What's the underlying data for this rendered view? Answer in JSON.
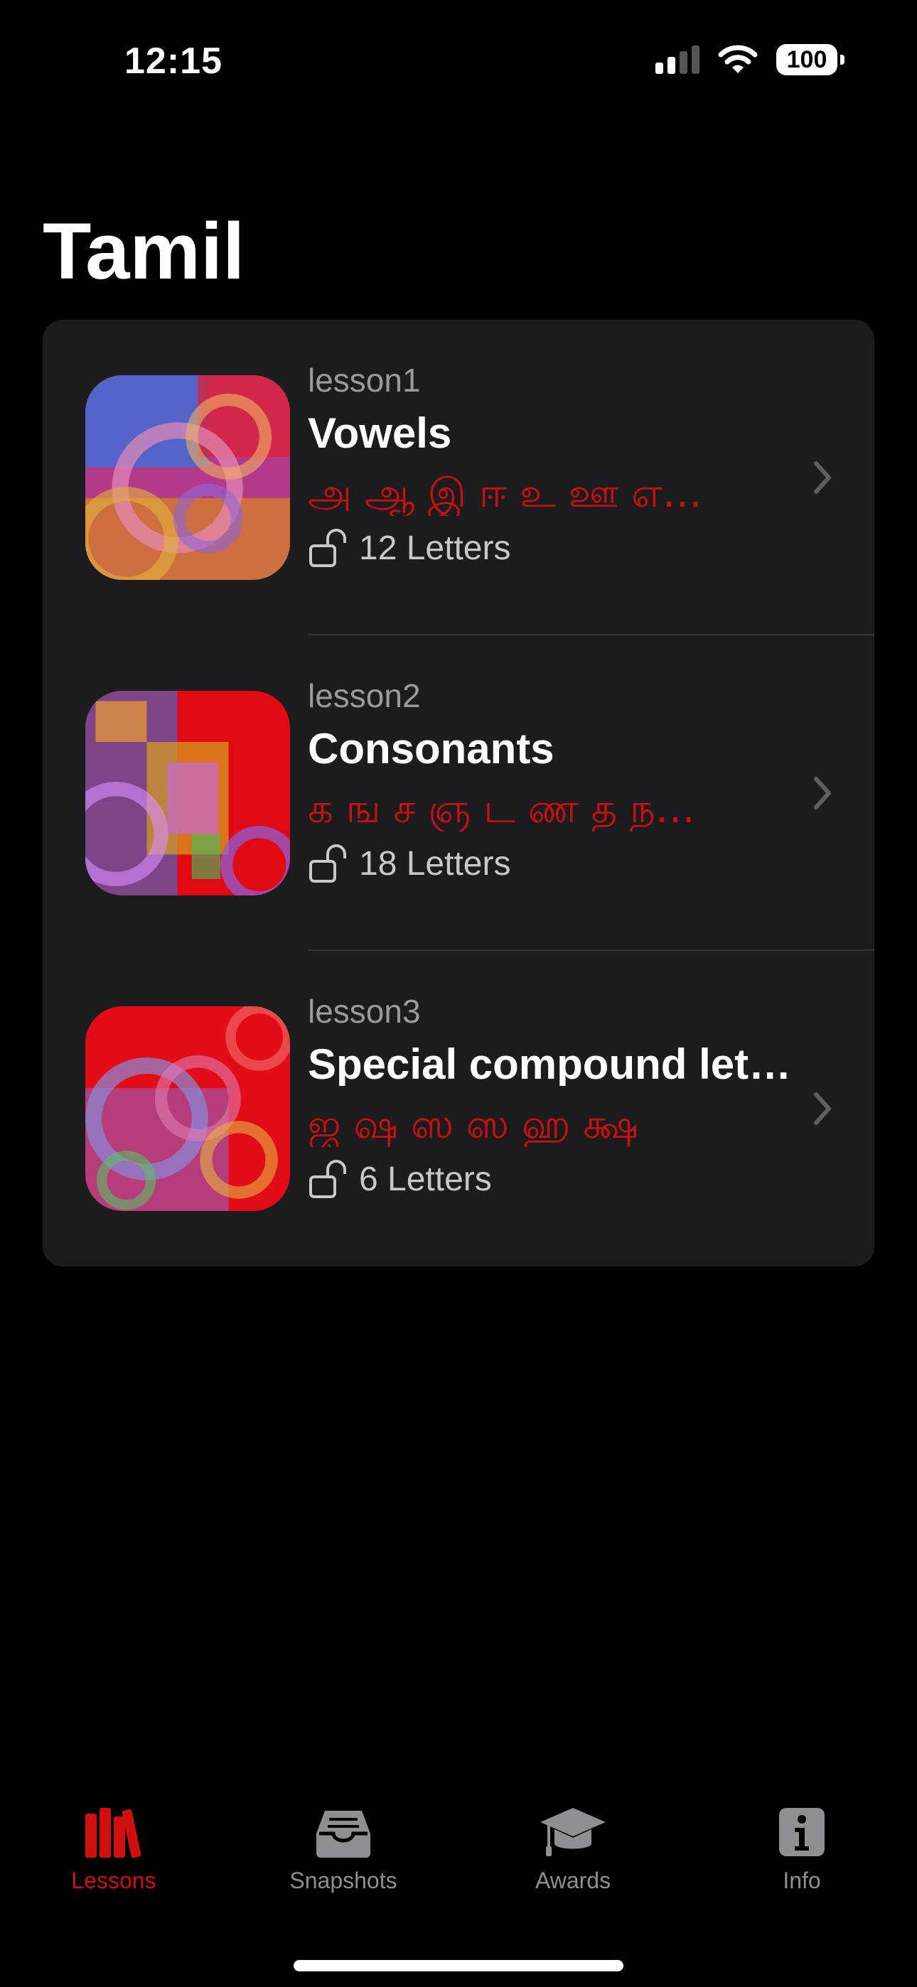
{
  "status": {
    "time": "12:15",
    "battery": "100"
  },
  "title": "Tamil",
  "lessons": [
    {
      "id": "lesson1",
      "title": "Vowels",
      "letters": "அ ஆ இ ஈ உ ஊ எ…",
      "count": "12 Letters"
    },
    {
      "id": "lesson2",
      "title": "Consonants",
      "letters": "க ங ச ஞ ட ண த ந…",
      "count": "18 Letters"
    },
    {
      "id": "lesson3",
      "title": "Special compound let…",
      "letters": "ஜ ஷ ஸ ஸ ஹ க்ஷ",
      "count": "6 Letters"
    }
  ],
  "tabs": [
    {
      "label": "Lessons",
      "icon": "books-icon",
      "active": true
    },
    {
      "label": "Snapshots",
      "icon": "tray-icon",
      "active": false
    },
    {
      "label": "Awards",
      "icon": "graduation-cap-icon",
      "active": false
    },
    {
      "label": "Info",
      "icon": "info-icon",
      "active": false
    }
  ],
  "colors": {
    "accent": "#d0100f",
    "card": "#1c1c1e",
    "letters": "#c81010",
    "inactive": "#8e8e93"
  }
}
